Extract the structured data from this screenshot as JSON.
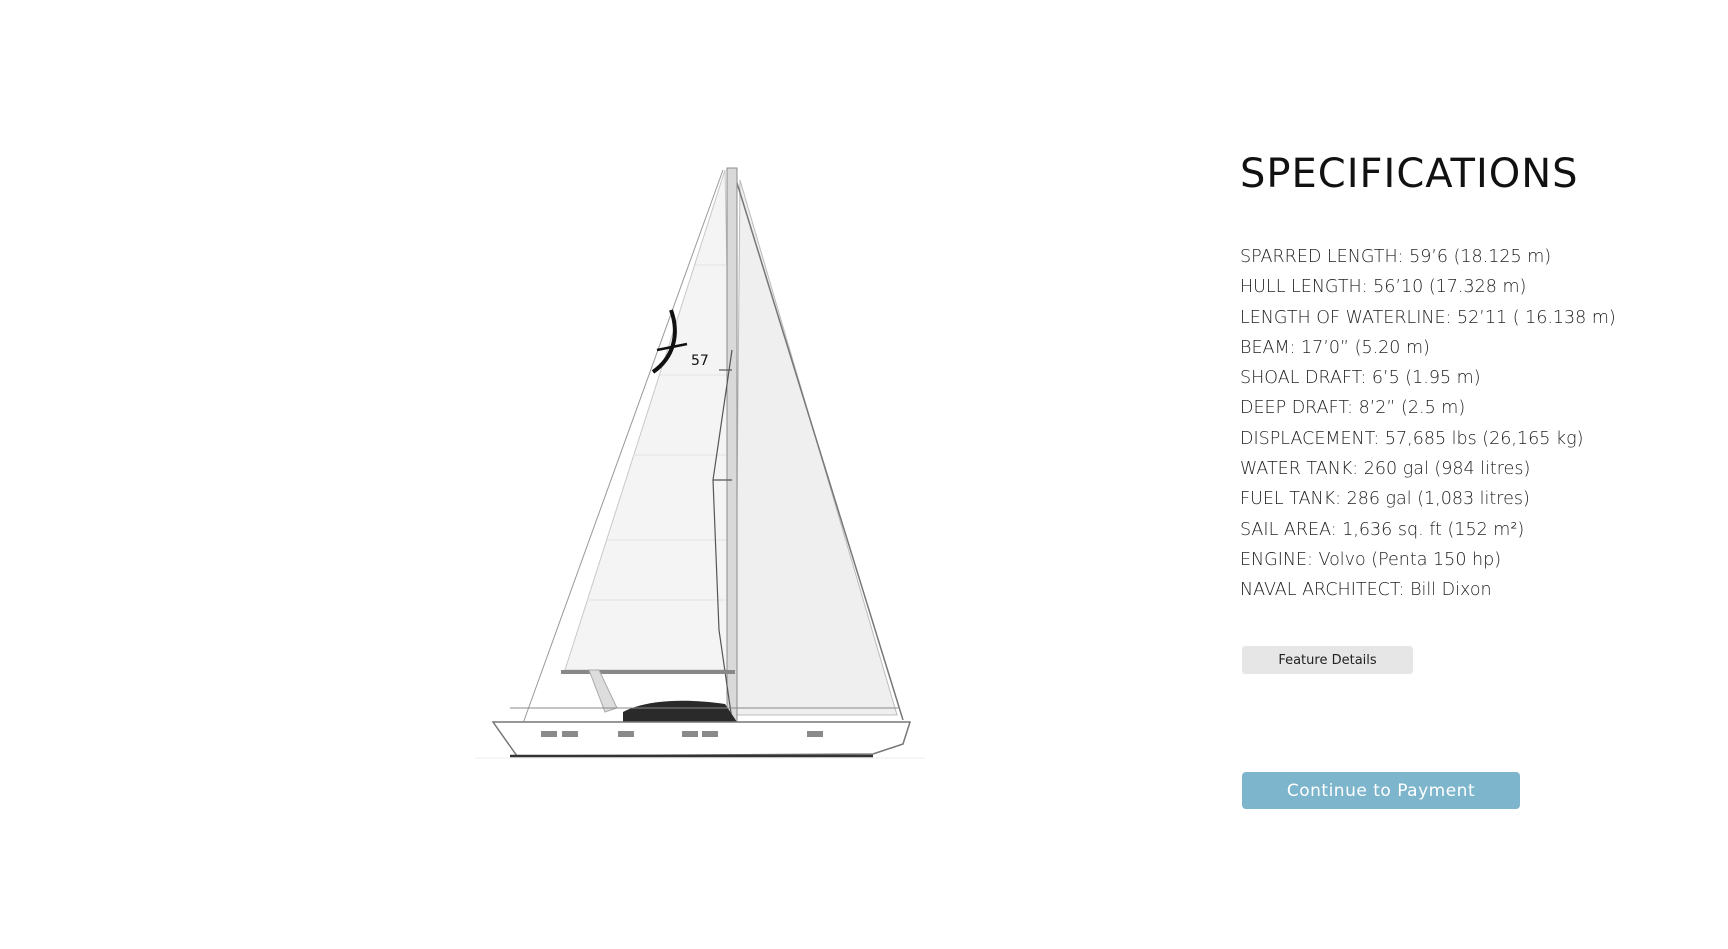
{
  "boat": {
    "sail_badge": "57"
  },
  "specifications": {
    "title": "SPECIFICATIONS",
    "items": [
      "SPARRED LENGTH: 59’6 (18.125 m)",
      "HULL LENGTH: 56’10   (17.328 m)",
      "LENGTH OF WATERLINE: 52’11  ( 16.138 m)",
      "BEAM: 17’0” (5.20 m)",
      "SHOAL DRAFT: 6’5  (1.95 m)",
      "DEEP DRAFT: 8’2” (2.5 m)",
      "DISPLACEMENT: 57,685 lbs (26,165 kg)",
      "WATER TANK: 260 gal (984 litres)",
      "FUEL TANK: 286 gal (1,083 litres)",
      "SAIL AREA: 1,636 sq. ft (152 m²)",
      "ENGINE: Volvo (Penta 150 hp)",
      "NAVAL ARCHITECT: Bill Dixon"
    ]
  },
  "buttons": {
    "feature_details": "Feature Details",
    "continue_payment": "Continue to Payment"
  },
  "colors": {
    "primary_button": "#7cb5cc",
    "secondary_button": "#e6e6e6",
    "heading": "#111111"
  }
}
